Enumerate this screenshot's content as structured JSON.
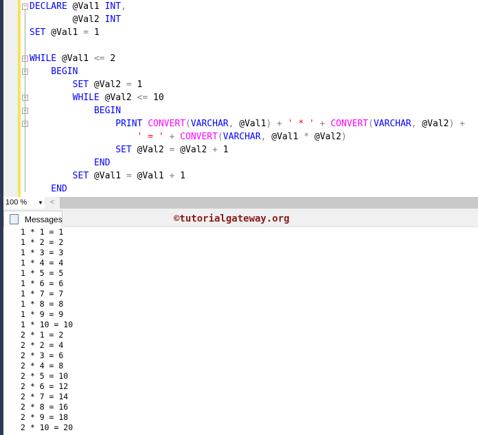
{
  "editor": {
    "lines": [
      [
        {
          "t": "DECLARE",
          "c": "kw"
        },
        {
          "t": " @Val1 ",
          "c": ""
        },
        {
          "t": "INT",
          "c": "kw"
        },
        {
          "t": ",",
          "c": "op"
        }
      ],
      [
        {
          "t": "        @Val2 ",
          "c": ""
        },
        {
          "t": "INT",
          "c": "kw"
        }
      ],
      [
        {
          "t": "SET",
          "c": "kw"
        },
        {
          "t": " @Val1 ",
          "c": ""
        },
        {
          "t": "=",
          "c": "op"
        },
        {
          "t": " 1",
          "c": ""
        }
      ],
      [],
      [
        {
          "t": "WHILE",
          "c": "kw"
        },
        {
          "t": " @Val1 ",
          "c": ""
        },
        {
          "t": "<=",
          "c": "op"
        },
        {
          "t": " 2",
          "c": ""
        }
      ],
      [
        {
          "t": "    BEGIN",
          "c": "kw"
        }
      ],
      [
        {
          "t": "        SET",
          "c": "kw"
        },
        {
          "t": " @Val2 ",
          "c": ""
        },
        {
          "t": "=",
          "c": "op"
        },
        {
          "t": " 1",
          "c": ""
        }
      ],
      [
        {
          "t": "        WHILE",
          "c": "kw"
        },
        {
          "t": " @Val2 ",
          "c": ""
        },
        {
          "t": "<=",
          "c": "op"
        },
        {
          "t": " 10",
          "c": ""
        }
      ],
      [
        {
          "t": "            BEGIN",
          "c": "kw"
        }
      ],
      [
        {
          "t": "                PRINT ",
          "c": "kw"
        },
        {
          "t": "CONVERT",
          "c": "fn"
        },
        {
          "t": "(",
          "c": "op"
        },
        {
          "t": "VARCHAR",
          "c": "kw"
        },
        {
          "t": ",",
          "c": "op"
        },
        {
          "t": " @Val1",
          "c": ""
        },
        {
          "t": ")",
          "c": "op"
        },
        {
          "t": " + ",
          "c": "op"
        },
        {
          "t": "' * '",
          "c": "str"
        },
        {
          "t": " + ",
          "c": "op"
        },
        {
          "t": "CONVERT",
          "c": "fn"
        },
        {
          "t": "(",
          "c": "op"
        },
        {
          "t": "VARCHAR",
          "c": "kw"
        },
        {
          "t": ",",
          "c": "op"
        },
        {
          "t": " @Val2",
          "c": ""
        },
        {
          "t": ")",
          "c": "op"
        },
        {
          "t": " +",
          "c": "op"
        }
      ],
      [
        {
          "t": "                    ",
          "c": ""
        },
        {
          "t": "' = '",
          "c": "str"
        },
        {
          "t": " + ",
          "c": "op"
        },
        {
          "t": "CONVERT",
          "c": "fn"
        },
        {
          "t": "(",
          "c": "op"
        },
        {
          "t": "VARCHAR",
          "c": "kw"
        },
        {
          "t": ",",
          "c": "op"
        },
        {
          "t": " @Val1 ",
          "c": ""
        },
        {
          "t": "*",
          "c": "op"
        },
        {
          "t": " @Val2",
          "c": ""
        },
        {
          "t": ")",
          "c": "op"
        }
      ],
      [
        {
          "t": "                SET",
          "c": "kw"
        },
        {
          "t": " @Val2 ",
          "c": ""
        },
        {
          "t": "=",
          "c": "op"
        },
        {
          "t": " @Val2 ",
          "c": ""
        },
        {
          "t": "+",
          "c": "op"
        },
        {
          "t": " 1",
          "c": ""
        }
      ],
      [
        {
          "t": "            END",
          "c": "kw"
        }
      ],
      [
        {
          "t": "        SET",
          "c": "kw"
        },
        {
          "t": " @Val1 ",
          "c": ""
        },
        {
          "t": "=",
          "c": "op"
        },
        {
          "t": " @Val1 ",
          "c": ""
        },
        {
          "t": "+",
          "c": "op"
        },
        {
          "t": " 1",
          "c": ""
        }
      ],
      [
        {
          "t": "    END",
          "c": "kw"
        }
      ]
    ],
    "fold_lines": [
      0,
      4,
      5,
      7,
      8,
      9
    ]
  },
  "zoom": {
    "value": "100 %"
  },
  "results": {
    "tab_label": "Messages",
    "watermark": "©tutorialgateway.org",
    "messages": [
      "1 * 1 = 1",
      "1 * 2 = 2",
      "1 * 3 = 3",
      "1 * 4 = 4",
      "1 * 5 = 5",
      "1 * 6 = 6",
      "1 * 7 = 7",
      "1 * 8 = 8",
      "1 * 9 = 9",
      "1 * 10 = 10",
      "2 * 1 = 2",
      "2 * 2 = 4",
      "2 * 3 = 6",
      "2 * 4 = 8",
      "2 * 5 = 10",
      "2 * 6 = 12",
      "2 * 7 = 14",
      "2 * 8 = 16",
      "2 * 9 = 18",
      "2 * 10 = 20"
    ]
  },
  "colors": {
    "keyword": "#0000ff",
    "function": "#ff00ff",
    "operator": "#808080",
    "string": "#ff0000",
    "watermark": "#8b1a1a"
  }
}
